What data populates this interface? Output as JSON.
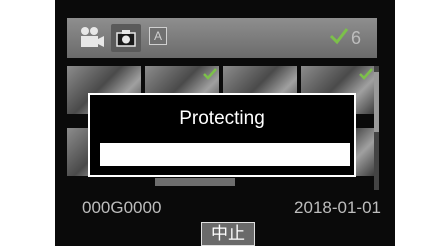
{
  "header": {
    "icons": [
      "video-mode-icon",
      "photo-mode-icon",
      "auto-mode-icon",
      "check-icon"
    ],
    "auto_label": "A",
    "protected_count": "6"
  },
  "thumbnails": {
    "count": 8,
    "checked": [
      1,
      3
    ]
  },
  "dialog": {
    "title": "Protecting"
  },
  "footer": {
    "file_name": "000G0000",
    "date": "2018-01-01",
    "cancel_label": "中止"
  },
  "colors": {
    "check_green": "#7cc04a",
    "background": "#0a0a0a",
    "text_gray": "#bdbdbd"
  }
}
